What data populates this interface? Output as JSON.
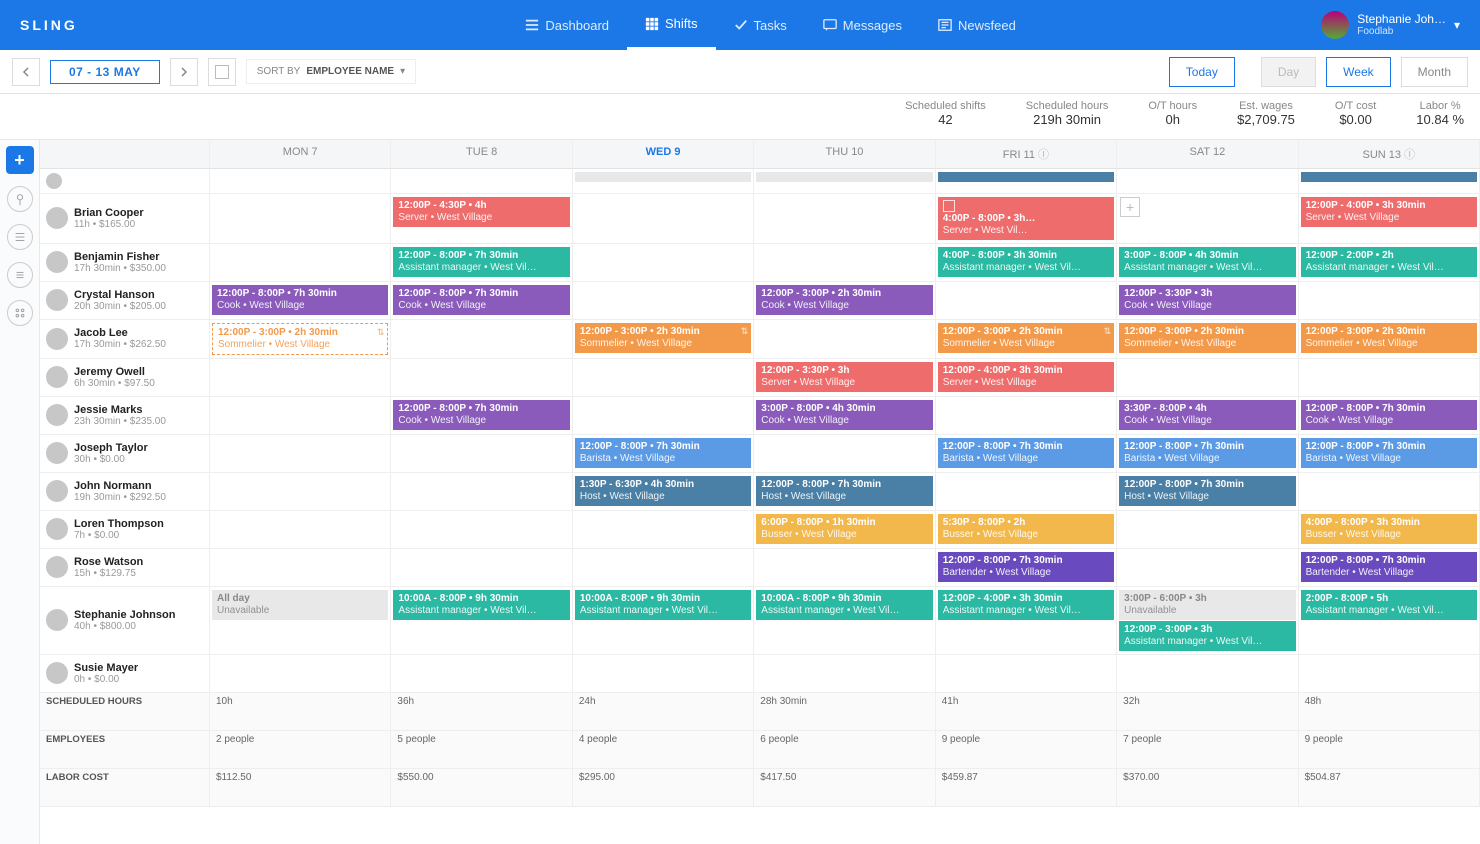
{
  "brand": "SLING",
  "nav": {
    "dashboard": "Dashboard",
    "shifts": "Shifts",
    "tasks": "Tasks",
    "messages": "Messages",
    "newsfeed": "Newsfeed"
  },
  "user": {
    "name": "Stephanie Joh…",
    "company": "Foodlab"
  },
  "toolbar": {
    "date_range": "07 - 13 MAY",
    "sort_label": "SORT BY",
    "sort_value": "EMPLOYEE NAME",
    "today": "Today",
    "day": "Day",
    "week": "Week",
    "month": "Month"
  },
  "stats": [
    {
      "label": "Scheduled shifts",
      "value": "42"
    },
    {
      "label": "Scheduled hours",
      "value": "219h 30min"
    },
    {
      "label": "O/T hours",
      "value": "0h"
    },
    {
      "label": "Est. wages",
      "value": "$2,709.75"
    },
    {
      "label": "O/T cost",
      "value": "$0.00"
    },
    {
      "label": "Labor %",
      "value": "10.84 %"
    }
  ],
  "days": [
    {
      "label": "MON 7"
    },
    {
      "label": "TUE 8"
    },
    {
      "label": "WED 9",
      "today": true
    },
    {
      "label": "THU 10"
    },
    {
      "label": "FRI 11",
      "info": true
    },
    {
      "label": "SAT 12"
    },
    {
      "label": "SUN 13",
      "info": true
    }
  ],
  "employees": [
    {
      "name": "Brian Cooper",
      "sub": "11h • $165.00",
      "cells": [
        [],
        [
          {
            "c": "red",
            "t": "12:00P - 4:30P • 4h",
            "r": "Server • West Village"
          }
        ],
        [],
        [],
        [
          {
            "c": "red withbox",
            "t": "4:00P - 8:00P • 3h…",
            "r": "Server • West Vil…",
            "plus": true
          }
        ],
        [],
        [
          {
            "c": "red",
            "t": "12:00P - 4:00P • 3h 30min",
            "r": "Server • West Village"
          }
        ]
      ]
    },
    {
      "name": "Benjamin Fisher",
      "sub": "17h 30min • $350.00",
      "cells": [
        [],
        [
          {
            "c": "teal",
            "t": "12:00P - 8:00P • 7h 30min",
            "r": "Assistant manager • West Vil…"
          }
        ],
        [],
        [],
        [
          {
            "c": "teal",
            "t": "4:00P - 8:00P • 3h 30min",
            "r": "Assistant manager • West Vil…"
          }
        ],
        [
          {
            "c": "teal",
            "t": "3:00P - 8:00P • 4h 30min",
            "r": "Assistant manager • West Vil…"
          }
        ],
        [
          {
            "c": "teal",
            "t": "12:00P - 2:00P • 2h",
            "r": "Assistant manager • West Vil…"
          }
        ]
      ]
    },
    {
      "name": "Crystal Hanson",
      "sub": "20h 30min • $205.00",
      "cells": [
        [
          {
            "c": "purple",
            "t": "12:00P - 8:00P • 7h 30min",
            "r": "Cook • West Village"
          }
        ],
        [
          {
            "c": "purple",
            "t": "12:00P - 8:00P • 7h 30min",
            "r": "Cook • West Village"
          }
        ],
        [],
        [
          {
            "c": "purple",
            "t": "12:00P - 3:00P • 2h 30min",
            "r": "Cook • West Village"
          }
        ],
        [],
        [
          {
            "c": "purple",
            "t": "12:00P - 3:30P • 3h",
            "r": "Cook • West Village"
          }
        ],
        []
      ]
    },
    {
      "name": "Jacob Lee",
      "sub": "17h 30min • $262.50",
      "cells": [
        [
          {
            "c": "outline",
            "t": "12:00P - 3:00P • 2h 30min",
            "r": "Sommelier • West Village",
            "chip": "⇅"
          }
        ],
        [],
        [
          {
            "c": "orange",
            "t": "12:00P - 3:00P • 2h 30min",
            "r": "Sommelier • West Village",
            "chip": "⇅"
          }
        ],
        [],
        [
          {
            "c": "orange",
            "t": "12:00P - 3:00P • 2h 30min",
            "r": "Sommelier • West Village",
            "chip": "⇅"
          }
        ],
        [
          {
            "c": "orange",
            "t": "12:00P - 3:00P • 2h 30min",
            "r": "Sommelier • West Village"
          }
        ],
        [
          {
            "c": "orange",
            "t": "12:00P - 3:00P • 2h 30min",
            "r": "Sommelier • West Village"
          }
        ]
      ]
    },
    {
      "name": "Jeremy Owell",
      "sub": "6h 30min • $97.50",
      "cells": [
        [],
        [],
        [],
        [
          {
            "c": "red",
            "t": "12:00P - 3:30P • 3h",
            "r": "Server • West Village"
          }
        ],
        [
          {
            "c": "red",
            "t": "12:00P - 4:00P • 3h 30min",
            "r": "Server • West Village"
          }
        ],
        [],
        []
      ]
    },
    {
      "name": "Jessie Marks",
      "sub": "23h 30min • $235.00",
      "cells": [
        [],
        [
          {
            "c": "purple",
            "t": "12:00P - 8:00P • 7h 30min",
            "r": "Cook • West Village"
          }
        ],
        [],
        [
          {
            "c": "purple",
            "t": "3:00P - 8:00P • 4h 30min",
            "r": "Cook • West Village"
          }
        ],
        [],
        [
          {
            "c": "purple",
            "t": "3:30P - 8:00P • 4h",
            "r": "Cook • West Village"
          }
        ],
        [
          {
            "c": "purple",
            "t": "12:00P - 8:00P • 7h 30min",
            "r": "Cook • West Village"
          }
        ]
      ]
    },
    {
      "name": "Joseph Taylor",
      "sub": "30h • $0.00",
      "cells": [
        [],
        [],
        [
          {
            "c": "blue",
            "t": "12:00P - 8:00P • 7h 30min",
            "r": "Barista • West Village"
          }
        ],
        [],
        [
          {
            "c": "blue",
            "t": "12:00P - 8:00P • 7h 30min",
            "r": "Barista • West Village"
          }
        ],
        [
          {
            "c": "blue",
            "t": "12:00P - 8:00P • 7h 30min",
            "r": "Barista • West Village"
          }
        ],
        [
          {
            "c": "blue",
            "t": "12:00P - 8:00P • 7h 30min",
            "r": "Barista • West Village"
          }
        ]
      ]
    },
    {
      "name": "John Normann",
      "sub": "19h 30min • $292.50",
      "cells": [
        [],
        [],
        [
          {
            "c": "steel",
            "t": "1:30P - 6:30P • 4h 30min",
            "r": "Host • West Village"
          }
        ],
        [
          {
            "c": "steel",
            "t": "12:00P - 8:00P • 7h 30min",
            "r": "Host • West Village"
          }
        ],
        [],
        [
          {
            "c": "steel",
            "t": "12:00P - 8:00P • 7h 30min",
            "r": "Host • West Village"
          }
        ],
        []
      ]
    },
    {
      "name": "Loren Thompson",
      "sub": "7h • $0.00",
      "cells": [
        [],
        [],
        [],
        [
          {
            "c": "amber",
            "t": "6:00P - 8:00P • 1h 30min",
            "r": "Busser • West Village"
          }
        ],
        [
          {
            "c": "amber",
            "t": "5:30P - 8:00P • 2h",
            "r": "Busser • West Village"
          }
        ],
        [],
        [
          {
            "c": "amber",
            "t": "4:00P - 8:00P • 3h 30min",
            "r": "Busser • West Village"
          }
        ]
      ]
    },
    {
      "name": "Rose Watson",
      "sub": "15h • $129.75",
      "cells": [
        [],
        [],
        [],
        [],
        [
          {
            "c": "violet",
            "t": "12:00P - 8:00P • 7h 30min",
            "r": "Bartender • West Village"
          }
        ],
        [],
        [
          {
            "c": "violet",
            "t": "12:00P - 8:00P • 7h 30min",
            "r": "Bartender • West Village"
          }
        ]
      ]
    },
    {
      "name": "Stephanie Johnson",
      "sub": "40h • $800.00",
      "cells": [
        [
          {
            "c": "gray",
            "t": "All day",
            "r": "Unavailable"
          }
        ],
        [
          {
            "c": "teal",
            "t": "10:00A - 8:00P • 9h 30min",
            "r": "Assistant manager • West Vil…"
          }
        ],
        [
          {
            "c": "teal",
            "t": "10:00A - 8:00P • 9h 30min",
            "r": "Assistant manager • West Vil…"
          }
        ],
        [
          {
            "c": "teal",
            "t": "10:00A - 8:00P • 9h 30min",
            "r": "Assistant manager • West Vil…"
          }
        ],
        [
          {
            "c": "teal",
            "t": "12:00P - 4:00P • 3h 30min",
            "r": "Assistant manager • West Vil…"
          }
        ],
        [
          {
            "c": "gray",
            "t": "3:00P - 6:00P • 3h",
            "r": "Unavailable"
          },
          {
            "c": "teal",
            "t": "12:00P - 3:00P • 3h",
            "r": "Assistant manager • West Vil…"
          }
        ],
        [
          {
            "c": "teal",
            "t": "2:00P - 8:00P • 5h",
            "r": "Assistant manager • West Vil…"
          }
        ]
      ]
    },
    {
      "name": "Susie Mayer",
      "sub": "0h • $0.00",
      "cells": [
        [],
        [],
        [],
        [],
        [],
        [],
        []
      ]
    }
  ],
  "footers": {
    "hours": {
      "label": "SCHEDULED HOURS",
      "v": [
        "10h",
        "36h",
        "24h",
        "28h 30min",
        "41h",
        "32h",
        "48h"
      ]
    },
    "people": {
      "label": "EMPLOYEES",
      "v": [
        "2 people",
        "5 people",
        "4 people",
        "6 people",
        "9 people",
        "7 people",
        "9 people"
      ]
    },
    "cost": {
      "label": "LABOR COST",
      "v": [
        "$112.50",
        "$550.00",
        "$295.00",
        "$417.50",
        "$459.87",
        "$370.00",
        "$504.87"
      ]
    }
  }
}
